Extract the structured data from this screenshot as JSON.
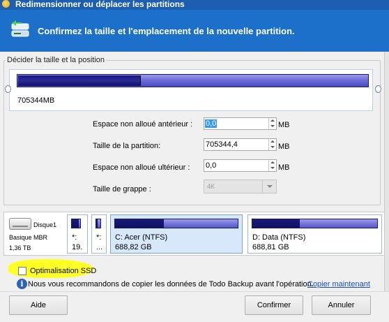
{
  "window": {
    "title": "Redimensionner ou déplacer les partitions"
  },
  "banner": {
    "text": "Confirmez la taille et l'emplacement de la nouvelle partition."
  },
  "group": {
    "label": "Décider la taille et la position",
    "bar_size": "705344MB",
    "bar_fill_fraction": 0.35
  },
  "fields": {
    "before": {
      "label": "Espace non alloué antérieur :",
      "value": "0,0",
      "unit": "MB"
    },
    "size": {
      "label": "Taille de la partition:",
      "value": "705344,4",
      "unit": "MB"
    },
    "after": {
      "label": "Espace non alloué ultérieur :",
      "value": "0,0",
      "unit": "MB"
    },
    "cluster": {
      "label": "Taille de grappe :",
      "value": "4K"
    }
  },
  "disk": {
    "name": "Disque1",
    "type": "Basique MBR",
    "size": "1,36 TB",
    "partitions": [
      {
        "line1": "*: ",
        "line2": "19.",
        "fill": 0.8
      },
      {
        "line1": "*: ",
        "line2": "...",
        "fill": 0.3
      },
      {
        "line1": "C: Acer (NTFS)",
        "line2": "688,82 GB",
        "fill": 0.4
      },
      {
        "line1": "D: Data (NTFS)",
        "line2": "688,81 GB",
        "fill": 0.38
      }
    ]
  },
  "ssd": {
    "label": "Optimalisation SSD",
    "checked": false
  },
  "recommendation": {
    "text": "Nous vous recommandons de copier les données de Todo Backup  avant l'opération.",
    "link": "Copier maintenant"
  },
  "buttons": {
    "help": "Aide",
    "confirm": "Confirmer",
    "cancel": "Annuler"
  },
  "colors": {
    "titlebar": "#1c5fb0",
    "banner": "#1d70c9",
    "bar": "#1a1a7a",
    "highlight": "#ffff24",
    "link": "#1a4dc9"
  }
}
